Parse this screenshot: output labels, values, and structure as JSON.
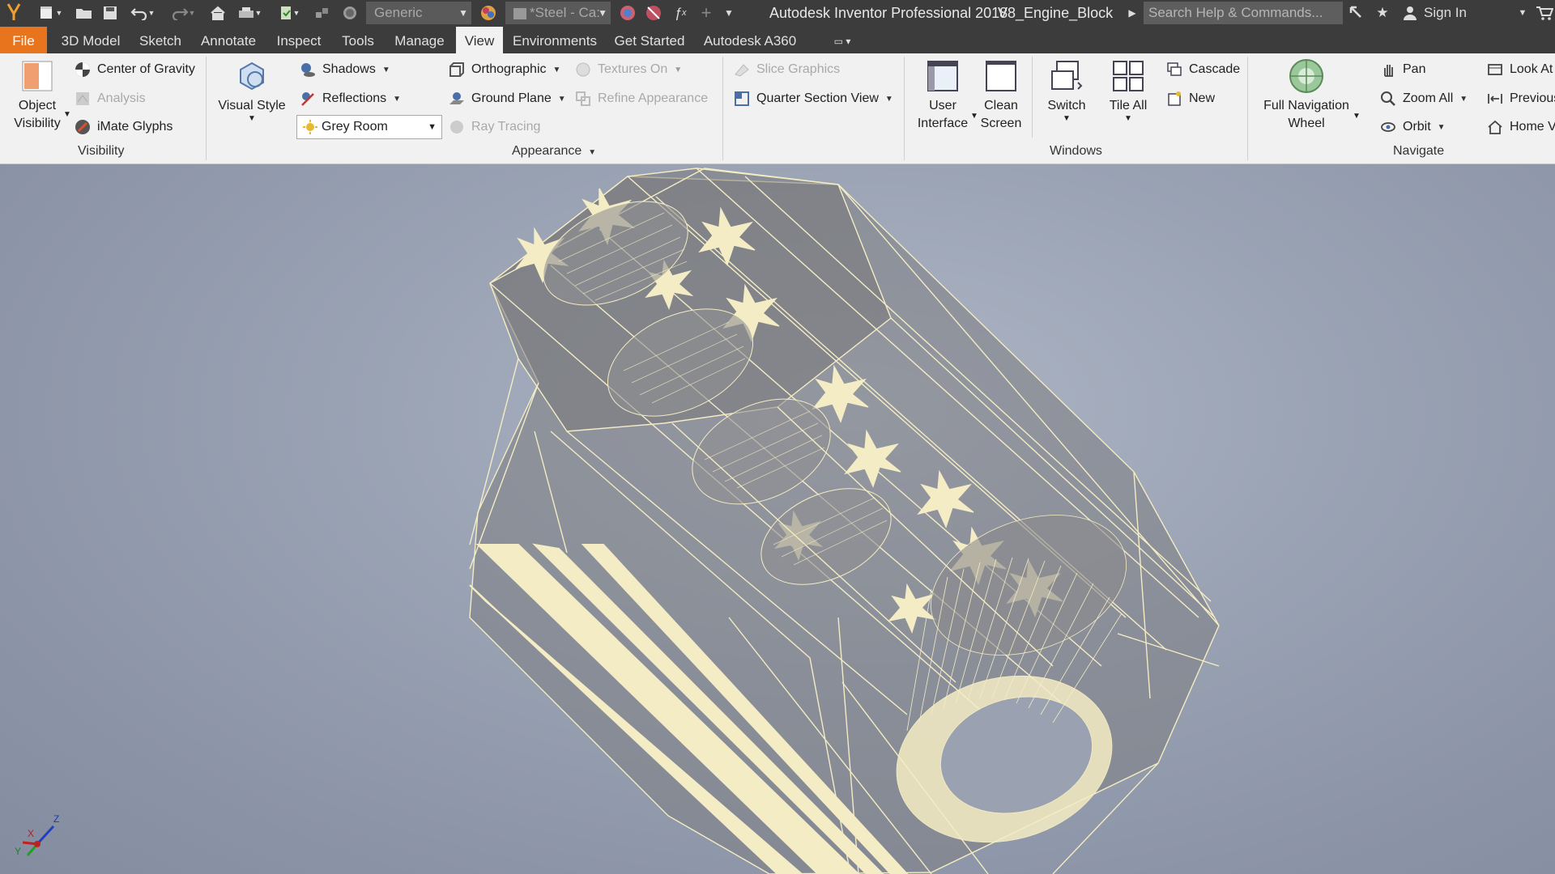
{
  "titlebar": {
    "app_title": "Autodesk Inventor Professional 2018",
    "document": "V8_Engine_Block",
    "search_placeholder": "Search Help & Commands...",
    "sign_in": "Sign In",
    "material_combo": "Generic",
    "appearance_combo": "*Steel - Ca:"
  },
  "tabs": [
    "File",
    "3D Model",
    "Sketch",
    "Annotate",
    "Inspect",
    "Tools",
    "Manage",
    "View",
    "Environments",
    "Get Started",
    "Autodesk A360"
  ],
  "active_tab": "View",
  "ribbon": {
    "visibility": {
      "object_visibility": [
        "Object",
        "Visibility"
      ],
      "center_of_gravity": "Center of Gravity",
      "analysis": "Analysis",
      "imate_glyphs": "iMate Glyphs",
      "panel_label": "Visibility"
    },
    "appearance": {
      "visual_style": "Visual Style",
      "shadows": "Shadows",
      "reflections": "Reflections",
      "environment_value": "Grey Room",
      "orthographic": "Orthographic",
      "ground_plane": "Ground Plane",
      "ray_tracing": "Ray Tracing",
      "textures_on": "Textures On",
      "refine_appearance": "Refine Appearance",
      "slice_graphics": "Slice Graphics",
      "quarter_section_view": "Quarter Section View",
      "panel_label": "Appearance"
    },
    "windows": {
      "user_interface": [
        "User",
        "Interface"
      ],
      "clean_screen": [
        "Clean",
        "Screen"
      ],
      "switch": "Switch",
      "tile_all": "Tile All",
      "cascade": "Cascade",
      "new": "New",
      "panel_label": "Windows"
    },
    "navigate": {
      "full_navigation_wheel": [
        "Full Navigation",
        "Wheel"
      ],
      "pan": "Pan",
      "zoom_all": "Zoom All",
      "orbit": "Orbit",
      "look_at": "Look At",
      "previous": "Previous",
      "home_view": "Home View",
      "panel_label": "Navigate"
    }
  },
  "viewport": {
    "axis_labels": {
      "x": "X",
      "y": "Y",
      "z": "Z"
    },
    "model_color": "#f4ecc4"
  }
}
